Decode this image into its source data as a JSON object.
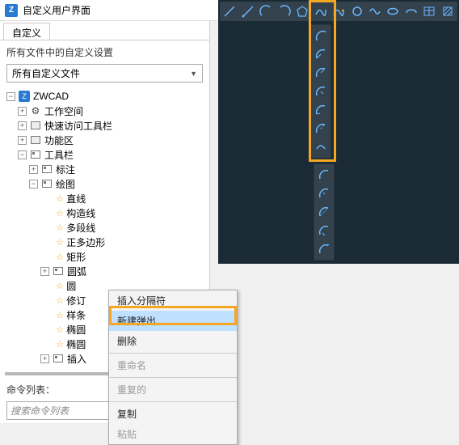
{
  "window": {
    "title": "自定义用户界面"
  },
  "left": {
    "tab": "自定义",
    "section_label": "所有文件中的自定义设置",
    "dropdown_value": "所有自定义文件",
    "tree": {
      "root": "ZWCAD",
      "n_workspace": "工作空间",
      "n_quickaccess": "快速访问工具栏",
      "n_ribbon": "功能区",
      "n_toolbar": "工具栏",
      "n_annotate": "标注",
      "n_draw": "绘图",
      "leaf_line": "直线",
      "leaf_xline": "构造线",
      "leaf_pline": "多段线",
      "leaf_polygon": "正多边形",
      "leaf_rect": "矩形",
      "n_arc": "圆弧",
      "leaf_circle": "圆",
      "leaf_rev": "修订",
      "leaf_spline": "样条",
      "leaf_ellipse1": "椭圆",
      "leaf_ellipse2": "椭圆",
      "n_insert": "插入"
    },
    "cmd_label": "命令列表：",
    "cmd_placeholder": "搜索命令列表"
  },
  "context_menu": {
    "items": {
      "insert_sep": "插入分隔符",
      "new_flyout": "新建弹出",
      "delete": "删除",
      "rename": "重命名",
      "duplicate": "重复的",
      "copy": "复制",
      "paste": "粘贴"
    }
  },
  "top_toolbar_icons": [
    "line",
    "ray",
    "arc-ccw",
    "arc-cw",
    "polygon",
    "spline1",
    "spline2",
    "circle",
    "wave",
    "ellipse",
    "ellipse-arc",
    "table",
    "hatch"
  ],
  "vstrip_a_icons": [
    "arc1",
    "arc2",
    "arc3",
    "arc4",
    "arc5",
    "arc6",
    "arc7"
  ],
  "vstrip_b_icons": [
    "arcb1",
    "arcb2",
    "arcb3",
    "arcb4",
    "arcb5"
  ]
}
